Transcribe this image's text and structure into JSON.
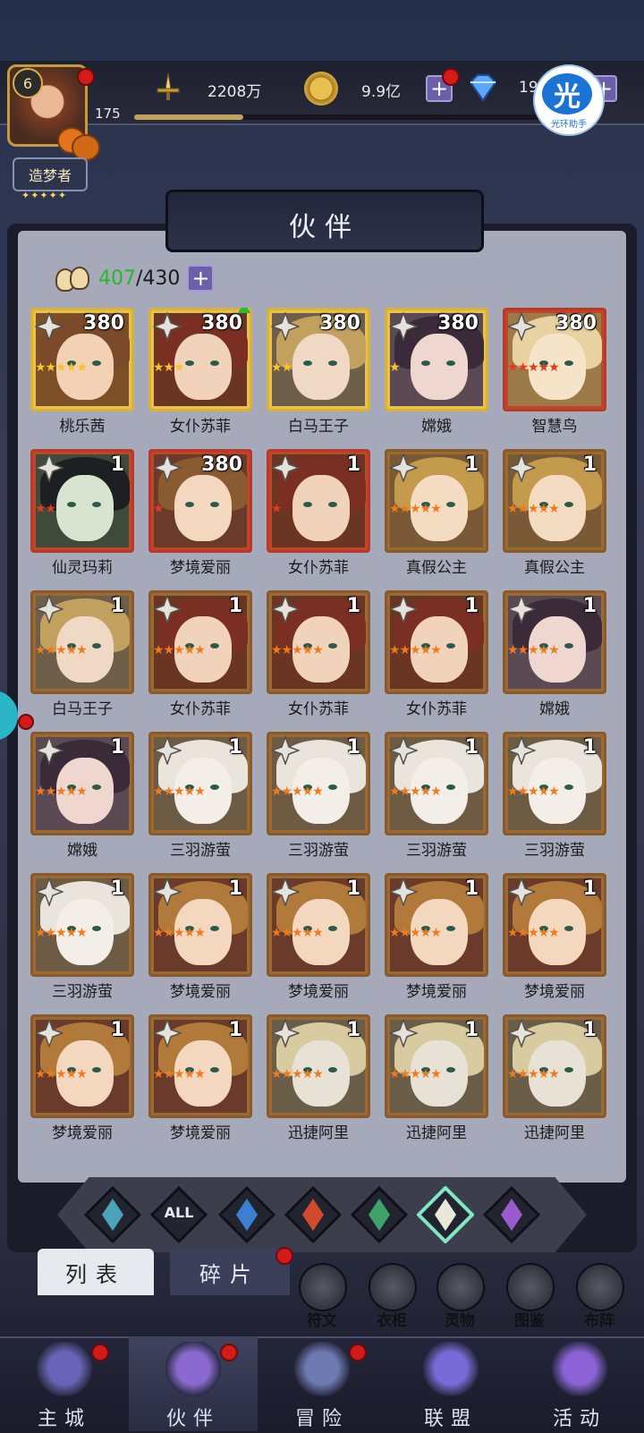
{
  "player": {
    "level": "6",
    "name_title": "造梦者",
    "badge_stars": "✦✦✦✦✦",
    "sub_value": "175"
  },
  "resources": {
    "power": "2208万",
    "gold": "9.9亿",
    "gems": "19"
  },
  "progress": {
    "xp_fraction": 0.24
  },
  "helper": {
    "icon_char": "光",
    "label": "光环助手"
  },
  "header": {
    "title": "伙伴"
  },
  "roster": {
    "current": "407",
    "slash": "/",
    "max": "430"
  },
  "cards": [
    {
      "name": "桃乐茜",
      "level": "380",
      "stars": 5,
      "star_color": "#f7c52e",
      "frame": "gold",
      "hair": "#7a4a2a",
      "skin": "#f2d1b5",
      "bg": "#7c4f26",
      "up": false,
      "gear": true
    },
    {
      "name": "女仆苏菲",
      "level": "380",
      "stars": 3,
      "star_color": "#f7c52e",
      "frame": "gold",
      "hair": "#7a2f22",
      "skin": "#f1d3bc",
      "bg": "#6b3524",
      "up": true
    },
    {
      "name": "白马王子",
      "level": "380",
      "stars": 2,
      "star_color": "#f7c52e",
      "frame": "gold",
      "hair": "#c2a15f",
      "skin": "#efd8c4",
      "bg": "#6d5f4a",
      "up": false
    },
    {
      "name": "嫦娥",
      "level": "380",
      "stars": 1,
      "star_color": "#f7c52e",
      "frame": "gold",
      "hair": "#3b2a3a",
      "skin": "#efd7cf",
      "bg": "#5b4a54",
      "up": false
    },
    {
      "name": "智慧鸟",
      "level": "380",
      "stars": 5,
      "star_color": "#e23a22",
      "frame": "red",
      "hair": "#e8d2a2",
      "skin": "#f6e4c8",
      "bg": "#9c7b48",
      "up": false
    },
    {
      "name": "仙灵玛莉",
      "level": "1",
      "stars": 2,
      "star_color": "#e23a22",
      "frame": "red",
      "hair": "#1d1f22",
      "skin": "#d8e3d0",
      "bg": "#3e4a3a",
      "up": false
    },
    {
      "name": "梦境爱丽",
      "level": "380",
      "stars": 1,
      "star_color": "#e23a22",
      "frame": "red",
      "hair": "#8a5a30",
      "skin": "#f3d7bf",
      "bg": "#6a3a2a",
      "up": false
    },
    {
      "name": "女仆苏菲",
      "level": "1",
      "stars": 1,
      "star_color": "#e23a22",
      "frame": "red",
      "hair": "#7a2f22",
      "skin": "#f1d3bc",
      "bg": "#6b3524",
      "up": false
    },
    {
      "name": "真假公主",
      "level": "1",
      "stars": 5,
      "star_color": "#f07a1e",
      "frame": "bronze",
      "hair": "#c49a4c",
      "skin": "#f4dcc3",
      "bg": "#7a5a36",
      "up": false
    },
    {
      "name": "真假公主",
      "level": "1",
      "stars": 5,
      "star_color": "#f07a1e",
      "frame": "bronze",
      "hair": "#c49a4c",
      "skin": "#f4dcc3",
      "bg": "#7a5a36",
      "up": false
    },
    {
      "name": "白马王子",
      "level": "1",
      "stars": 5,
      "star_color": "#f07a1e",
      "frame": "bronze",
      "hair": "#c2a15f",
      "skin": "#efd8c4",
      "bg": "#6d5f4a",
      "up": false
    },
    {
      "name": "女仆苏菲",
      "level": "1",
      "stars": 5,
      "star_color": "#f07a1e",
      "frame": "bronze",
      "hair": "#7a2f22",
      "skin": "#f1d3bc",
      "bg": "#6b3524",
      "up": false
    },
    {
      "name": "女仆苏菲",
      "level": "1",
      "stars": 5,
      "star_color": "#f07a1e",
      "frame": "bronze",
      "hair": "#7a2f22",
      "skin": "#f1d3bc",
      "bg": "#6b3524",
      "up": false
    },
    {
      "name": "女仆苏菲",
      "level": "1",
      "stars": 5,
      "star_color": "#f07a1e",
      "frame": "bronze",
      "hair": "#7a2f22",
      "skin": "#f1d3bc",
      "bg": "#6b3524",
      "up": false
    },
    {
      "name": "嫦娥",
      "level": "1",
      "stars": 5,
      "star_color": "#f07a1e",
      "frame": "bronze",
      "hair": "#3b2a3a",
      "skin": "#efd7cf",
      "bg": "#5b4a54",
      "up": false
    },
    {
      "name": "嫦娥",
      "level": "1",
      "stars": 5,
      "star_color": "#f07a1e",
      "frame": "bronze",
      "hair": "#3b2a3a",
      "skin": "#efd7cf",
      "bg": "#5b4a54",
      "up": false
    },
    {
      "name": "三羽游萤",
      "level": "1",
      "stars": 5,
      "star_color": "#f07a1e",
      "frame": "bronze",
      "hair": "#e9e4dc",
      "skin": "#f3efe8",
      "bg": "#6e5b44",
      "up": false
    },
    {
      "name": "三羽游萤",
      "level": "1",
      "stars": 5,
      "star_color": "#f07a1e",
      "frame": "bronze",
      "hair": "#e9e4dc",
      "skin": "#f3efe8",
      "bg": "#6e5b44",
      "up": false
    },
    {
      "name": "三羽游萤",
      "level": "1",
      "stars": 5,
      "star_color": "#f07a1e",
      "frame": "bronze",
      "hair": "#e9e4dc",
      "skin": "#f3efe8",
      "bg": "#6e5b44",
      "up": false
    },
    {
      "name": "三羽游萤",
      "level": "1",
      "stars": 5,
      "star_color": "#f07a1e",
      "frame": "bronze",
      "hair": "#e9e4dc",
      "skin": "#f3efe8",
      "bg": "#6e5b44",
      "up": false
    },
    {
      "name": "三羽游萤",
      "level": "1",
      "stars": 5,
      "star_color": "#f07a1e",
      "frame": "bronze",
      "hair": "#e9e4dc",
      "skin": "#f3efe8",
      "bg": "#6e5b44",
      "up": false
    },
    {
      "name": "梦境爱丽",
      "level": "1",
      "stars": 5,
      "star_color": "#f07a1e",
      "frame": "bronze",
      "hair": "#b27a3a",
      "skin": "#f3d7bf",
      "bg": "#6a3a2a",
      "up": false
    },
    {
      "name": "梦境爱丽",
      "level": "1",
      "stars": 5,
      "star_color": "#f07a1e",
      "frame": "bronze",
      "hair": "#b27a3a",
      "skin": "#f3d7bf",
      "bg": "#6a3a2a",
      "up": false
    },
    {
      "name": "梦境爱丽",
      "level": "1",
      "stars": 5,
      "star_color": "#f07a1e",
      "frame": "bronze",
      "hair": "#b27a3a",
      "skin": "#f3d7bf",
      "bg": "#6a3a2a",
      "up": false
    },
    {
      "name": "梦境爱丽",
      "level": "1",
      "stars": 5,
      "star_color": "#f07a1e",
      "frame": "bronze",
      "hair": "#b27a3a",
      "skin": "#f3d7bf",
      "bg": "#6a3a2a",
      "up": false
    },
    {
      "name": "梦境爱丽",
      "level": "1",
      "stars": 5,
      "star_color": "#f07a1e",
      "frame": "bronze",
      "hair": "#b27a3a",
      "skin": "#f3d7bf",
      "bg": "#6a3a2a",
      "up": false
    },
    {
      "name": "梦境爱丽",
      "level": "1",
      "stars": 5,
      "star_color": "#f07a1e",
      "frame": "bronze",
      "hair": "#b27a3a",
      "skin": "#f3d7bf",
      "bg": "#6a3a2a",
      "up": false
    },
    {
      "name": "迅捷阿里",
      "level": "1",
      "stars": 5,
      "star_color": "#f07a1e",
      "frame": "bronze",
      "hair": "#d8cba0",
      "skin": "#e8e2d6",
      "bg": "#6b5e48",
      "up": false
    },
    {
      "name": "迅捷阿里",
      "level": "1",
      "stars": 5,
      "star_color": "#f07a1e",
      "frame": "bronze",
      "hair": "#d8cba0",
      "skin": "#e8e2d6",
      "bg": "#6b5e48",
      "up": false
    },
    {
      "name": "迅捷阿里",
      "level": "1",
      "stars": 5,
      "star_color": "#f07a1e",
      "frame": "bronze",
      "hair": "#d8cba0",
      "skin": "#e8e2d6",
      "bg": "#6b5e48",
      "up": false
    }
  ],
  "filters": [
    {
      "id": "wind",
      "label": "",
      "color": "#4aa3b8"
    },
    {
      "id": "all",
      "label": "ALL",
      "color": "#d9dbe8"
    },
    {
      "id": "water",
      "label": "",
      "color": "#3b7fd0"
    },
    {
      "id": "fire",
      "label": "",
      "color": "#d04a2c"
    },
    {
      "id": "nature",
      "label": "",
      "color": "#3fa36a"
    },
    {
      "id": "light",
      "label": "",
      "color": "#e9e7d8"
    },
    {
      "id": "dark",
      "label": "",
      "color": "#9a5ad0"
    }
  ],
  "tabs": {
    "list": "列表",
    "fragments": "碎片"
  },
  "tools": [
    {
      "id": "runes",
      "label": "符文"
    },
    {
      "id": "wardrobe",
      "label": "衣柜"
    },
    {
      "id": "spirit",
      "label": "灵物"
    },
    {
      "id": "codex",
      "label": "图鉴"
    },
    {
      "id": "formation",
      "label": "布阵"
    }
  ],
  "nav": [
    {
      "id": "city",
      "label": "主城"
    },
    {
      "id": "partners",
      "label": "伙伴"
    },
    {
      "id": "adventure",
      "label": "冒险"
    },
    {
      "id": "alliance",
      "label": "联盟"
    },
    {
      "id": "events",
      "label": "活动"
    }
  ],
  "colors": {
    "accent": "#6b5fa8",
    "panel": "#a5a9b9",
    "alert": "#d51a1a",
    "count_green": "#27b82a"
  }
}
